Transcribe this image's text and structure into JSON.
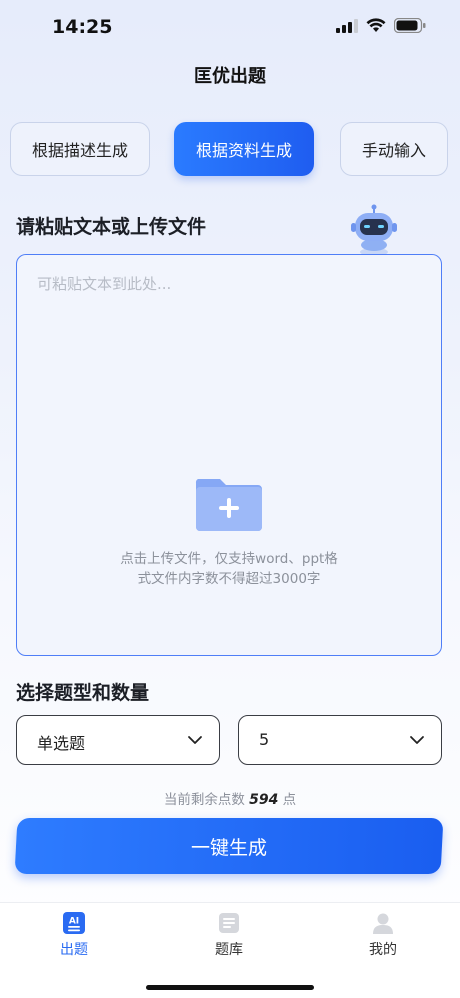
{
  "status": {
    "time": "14:25"
  },
  "header": {
    "title": "匡优出题"
  },
  "tabs": [
    {
      "label": "根据描述生成",
      "active": false
    },
    {
      "label": "根据资料生成",
      "active": true
    },
    {
      "label": "手动输入",
      "active": false
    }
  ],
  "upload": {
    "section_title": "请粘贴文本或上传文件",
    "placeholder": "可粘贴文本到此处...",
    "hint_line1": "点击上传文件，仅支持word、ppt格",
    "hint_line2": "式文件内字数不得超过3000字"
  },
  "question_type": {
    "section_title": "选择题型和数量",
    "type_value": "单选题",
    "count_value": "5"
  },
  "remaining": {
    "prefix": "当前剩余点数",
    "points": "594",
    "suffix": "点"
  },
  "generate_label": "一键生成",
  "tabbar": [
    {
      "label": "出题",
      "active": true,
      "icon": "ai-icon"
    },
    {
      "label": "题库",
      "active": false,
      "icon": "question-bank-icon"
    },
    {
      "label": "我的",
      "active": false,
      "icon": "profile-icon"
    }
  ],
  "colors": {
    "accent": "#2a6bf2",
    "box_border": "#4f7ef7"
  }
}
